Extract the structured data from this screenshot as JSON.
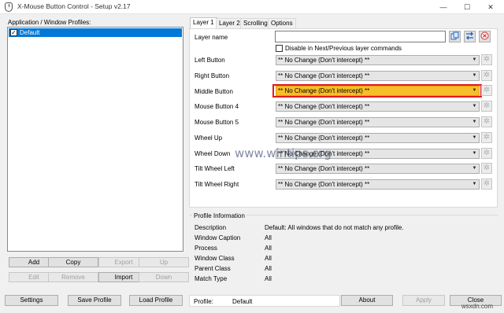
{
  "window": {
    "title": "X-Mouse Button Control - Setup v2.17",
    "controls": {
      "minimize": "—",
      "maximize": "☐",
      "close": "✕"
    }
  },
  "profiles": {
    "label": "Application / Window Profiles:",
    "items": [
      {
        "name": "Default",
        "checked": true,
        "selected": true
      }
    ],
    "buttons": {
      "add": "Add",
      "copy": "Copy",
      "export": "Export",
      "up": "Up",
      "edit": "Edit",
      "remove": "Remove",
      "import": "Import",
      "down": "Down"
    }
  },
  "tabs": [
    "Layer 1",
    "Layer 2",
    "Scrolling",
    "Options"
  ],
  "layer": {
    "name_label": "Layer name",
    "name_value": "",
    "disable_label": "Disable in Next/Previous layer commands",
    "disable_checked": false,
    "rows": [
      {
        "label": "Left Button",
        "value": "** No Change (Don't intercept) **"
      },
      {
        "label": "Right Button",
        "value": "** No Change (Don't intercept) **"
      },
      {
        "label": "Middle Button",
        "value": "** No Change (Don't intercept) **",
        "highlighted": true
      },
      {
        "label": "Mouse Button 4",
        "value": "** No Change (Don't intercept) **"
      },
      {
        "label": "Mouse Button 5",
        "value": "** No Change (Don't intercept) **"
      },
      {
        "label": "Wheel Up",
        "value": "** No Change (Don't intercept) **"
      },
      {
        "label": "Wheel Down",
        "value": "** No Change (Don't intercept) **"
      },
      {
        "label": "Tilt Wheel Left",
        "value": "** No Change (Don't intercept) **"
      },
      {
        "label": "Tilt Wheel Right",
        "value": "** No Change (Don't intercept) **"
      }
    ],
    "icons": [
      "copy-icon",
      "swap-icon",
      "reset-icon",
      "gear-icon"
    ]
  },
  "profile_info": {
    "title": "Profile Information",
    "rows": [
      {
        "key": "Description",
        "value": "Default: All windows that do not match any profile."
      },
      {
        "key": "Window Caption",
        "value": "All"
      },
      {
        "key": "Process",
        "value": "All"
      },
      {
        "key": "Window Class",
        "value": "All"
      },
      {
        "key": "Parent Class",
        "value": "All"
      },
      {
        "key": "Match Type",
        "value": "All"
      }
    ]
  },
  "bottom": {
    "settings": "Settings",
    "save_profile": "Save Profile",
    "load_profile": "Load Profile",
    "profile_label": "Profile:",
    "profile_value": "Default",
    "about": "About",
    "apply": "Apply",
    "close": "Close"
  },
  "watermarks": {
    "center": "www.wintips.org",
    "corner": "wsxdn.com"
  },
  "colors": {
    "selection": "#0078d7",
    "highlight_combo": "#f6be29",
    "highlight_border": "#e21b1b"
  }
}
